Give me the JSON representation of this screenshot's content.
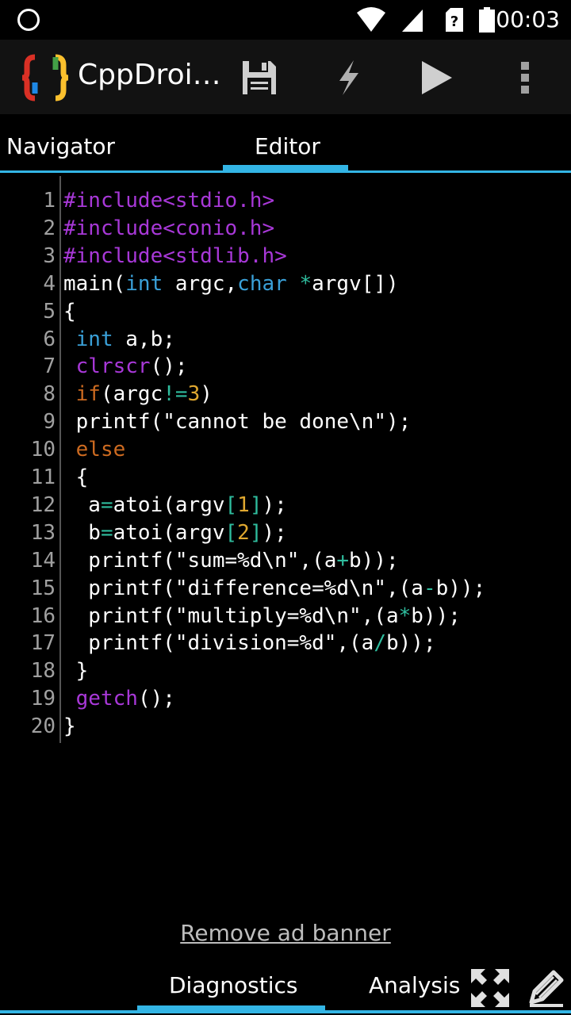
{
  "status_bar": {
    "time": "00:03",
    "icons": [
      "circle-icon",
      "wifi-icon",
      "signal-icon",
      "sim-icon",
      "battery-icon"
    ]
  },
  "action_bar": {
    "title": "CppDroi…",
    "actions": [
      "save-icon",
      "flash-icon",
      "play-icon",
      "overflow-menu-icon"
    ]
  },
  "tabs": [
    {
      "label": "Navigator",
      "selected": false
    },
    {
      "label": "Editor",
      "selected": true
    }
  ],
  "editor": {
    "lines": [
      {
        "n": "1",
        "html": "<span class=\"pp\">#include&lt;stdio.h&gt;</span>"
      },
      {
        "n": "2",
        "html": "<span class=\"pp\">#include&lt;conio.h&gt;</span>"
      },
      {
        "n": "3",
        "html": "<span class=\"pp\">#include&lt;stdlib.h&gt;</span>"
      },
      {
        "n": "4",
        "html": "main(<span class=\"kw\">int</span> argc,<span class=\"kw\">char</span> <span class=\"op\">*</span>argv[])"
      },
      {
        "n": "5",
        "html": "{"
      },
      {
        "n": "6",
        "html": " <span class=\"kw\">int</span> a,b;"
      },
      {
        "n": "7",
        "html": " <span class=\"fn\">clrscr</span>();"
      },
      {
        "n": "8",
        "html": " <span class=\"ctl\">if</span>(argc<span class=\"op\">!=</span><span class=\"num\">3</span>)"
      },
      {
        "n": "9",
        "html": " printf(\"cannot be done\\n\");"
      },
      {
        "n": "10",
        "html": " <span class=\"ctl\">else</span>"
      },
      {
        "n": "11",
        "html": " {"
      },
      {
        "n": "12",
        "html": "  a<span class=\"op\">=</span>atoi(argv<span class=\"op\">[</span><span class=\"num\">1</span><span class=\"op\">]</span>);"
      },
      {
        "n": "13",
        "html": "  b<span class=\"op\">=</span>atoi(argv<span class=\"op\">[</span><span class=\"num\">2</span><span class=\"op\">]</span>);"
      },
      {
        "n": "14",
        "html": "  printf(\"sum=%d\\n\",(a<span class=\"op\">+</span>b));"
      },
      {
        "n": "15",
        "html": "  printf(\"difference=%d\\n\",(a<span class=\"op\">-</span>b));"
      },
      {
        "n": "16",
        "html": "  printf(\"multiply=%d\\n\",(a<span class=\"op\">*</span>b));"
      },
      {
        "n": "17",
        "html": "  printf(\"division=%d\",(a<span class=\"op\">/</span>b));"
      },
      {
        "n": "18",
        "html": " }"
      },
      {
        "n": "19",
        "html": " <span class=\"fn\">getch</span>();"
      },
      {
        "n": "20",
        "html": "}"
      }
    ]
  },
  "ad": {
    "label": "Remove ad banner"
  },
  "bottom_tabs": [
    {
      "label": "Diagnostics",
      "selected": true
    },
    {
      "label": "Analysis",
      "selected": false
    }
  ],
  "bottom_actions": [
    "fullscreen-icon",
    "edit-pencil-icon"
  ],
  "colors": {
    "accent": "#33b5e5",
    "preprocessor": "#a838d8",
    "keyword": "#3aa0d8",
    "operator": "#2fbd9e",
    "number": "#e0a830",
    "control": "#cc6a20"
  }
}
